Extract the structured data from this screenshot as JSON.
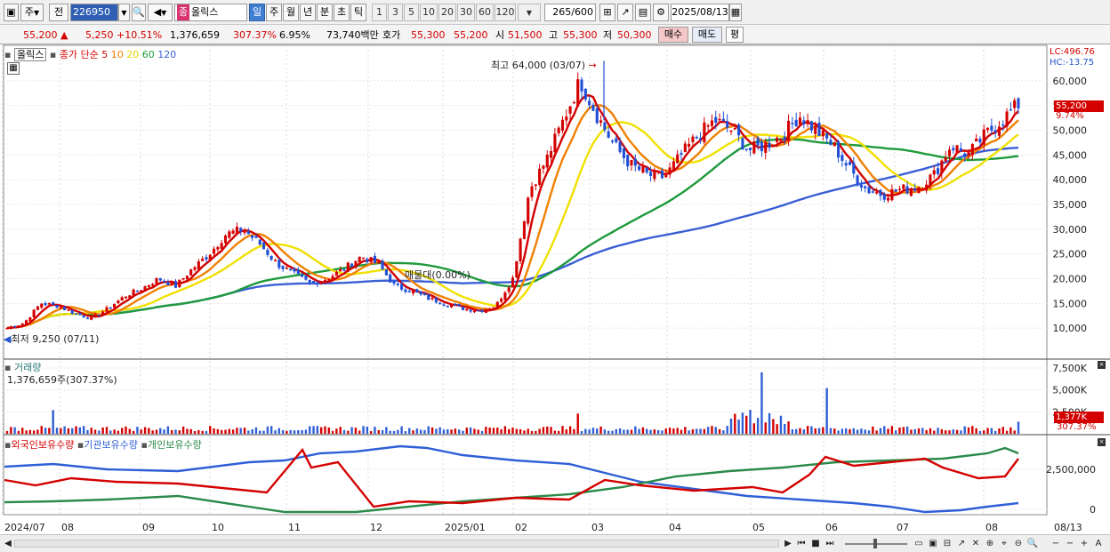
{
  "toolbar": {
    "period_mode": "주",
    "prev_label": "전",
    "code": "226950",
    "stock_name": "올릭스",
    "jong_badge": "종",
    "period_tabs": [
      "일",
      "주",
      "월",
      "년",
      "분",
      "초",
      "틱"
    ],
    "active_period": "일",
    "interval_buttons": [
      "1",
      "3",
      "5",
      "10",
      "20",
      "30",
      "60",
      "120"
    ],
    "count_value": "265",
    "count_max": "/600",
    "date_value": "2025/08/13"
  },
  "quote": {
    "price": "55,200",
    "arrow": "▲",
    "change": "5,250",
    "change_pct": "+10.51%",
    "volume": "1,376,659",
    "volume_ratio": "307.37%",
    "turnover": "6.95%",
    "amount": "73,740백만",
    "ask_label": "호가",
    "ask1": "55,300",
    "bid1": "55,200",
    "open_label": "시",
    "open": "51,500",
    "high_label": "고",
    "high": "55,300",
    "low_label": "저",
    "low": "50,300",
    "buy_label": "매수",
    "sell_label": "매도",
    "eval_label": "평"
  },
  "legend": {
    "stock": "올릭스",
    "ma_title": "종가 단순",
    "ma_periods": [
      "5",
      "10",
      "20",
      "60",
      "120"
    ],
    "ma_colors": [
      "#d40000",
      "#f08000",
      "#f0e000",
      "#1e9a3c",
      "#3a5fd6"
    ]
  },
  "right_labels": {
    "lc": "LC:496.76",
    "hc": "HC:-13.75",
    "price_tag": "55,200",
    "pct_tag": "9.74%",
    "vol_tag": "1,377K",
    "vol_pct_tag": "307.37%"
  },
  "annotations": {
    "high": "최고 64,000 (03/07)",
    "low": "최저 9,250 (07/11)",
    "label_mid": "매물대(0.00%)"
  },
  "volume_panel": {
    "title": "거래량",
    "value": "1,376,659주(307.37%)"
  },
  "holdings_panel": {
    "foreign": "외국인보유수량",
    "institution": "기관보유수량",
    "individual": "개인보유수량"
  },
  "x_axis_labels": [
    "2024/07",
    "08",
    "09",
    "10",
    "11",
    "12",
    "2025/01",
    "02",
    "03",
    "04",
    "05",
    "06",
    "07",
    "08",
    "08/13"
  ],
  "chart_data": [
    {
      "type": "candlestick",
      "title": "",
      "ylim": [
        5000,
        65000
      ],
      "y_ticks": [
        "10,000",
        "15,000",
        "20,000",
        "25,000",
        "30,000",
        "35,000",
        "40,000",
        "45,000",
        "50,000",
        "55,000",
        "60,000"
      ],
      "close_series_approx": [
        10000,
        11000,
        15000,
        14500,
        13000,
        12000,
        14000,
        16500,
        18000,
        20000,
        18500,
        22000,
        25000,
        29000,
        30000,
        27000,
        23000,
        21000,
        19000,
        20000,
        22000,
        24500,
        23000,
        18500,
        17500,
        16000,
        15000,
        14000,
        13500,
        14500,
        20000,
        38000,
        44000,
        52000,
        60000,
        53000,
        47000,
        43000,
        41000,
        40500,
        45000,
        49000,
        52000,
        50000,
        46000,
        47000,
        49000,
        53000,
        50000,
        47000,
        42000,
        38000,
        37000,
        38000,
        38500,
        41000,
        47000,
        45000,
        49000,
        52000,
        55200
      ]
    },
    {
      "type": "bar",
      "title": "거래량",
      "y_ticks": [
        "2,500K",
        "5,000K",
        "7,500K"
      ],
      "ylim": [
        0,
        8000
      ]
    },
    {
      "type": "line",
      "title": "",
      "series": [
        {
          "name": "외국인보유수량",
          "color": "#d40000"
        },
        {
          "name": "기관보유수량",
          "color": "#2f5fd6"
        },
        {
          "name": "개인보유수량",
          "color": "#2a8a4a"
        }
      ],
      "y_ticks": [
        "0",
        "2,500,000"
      ]
    }
  ]
}
